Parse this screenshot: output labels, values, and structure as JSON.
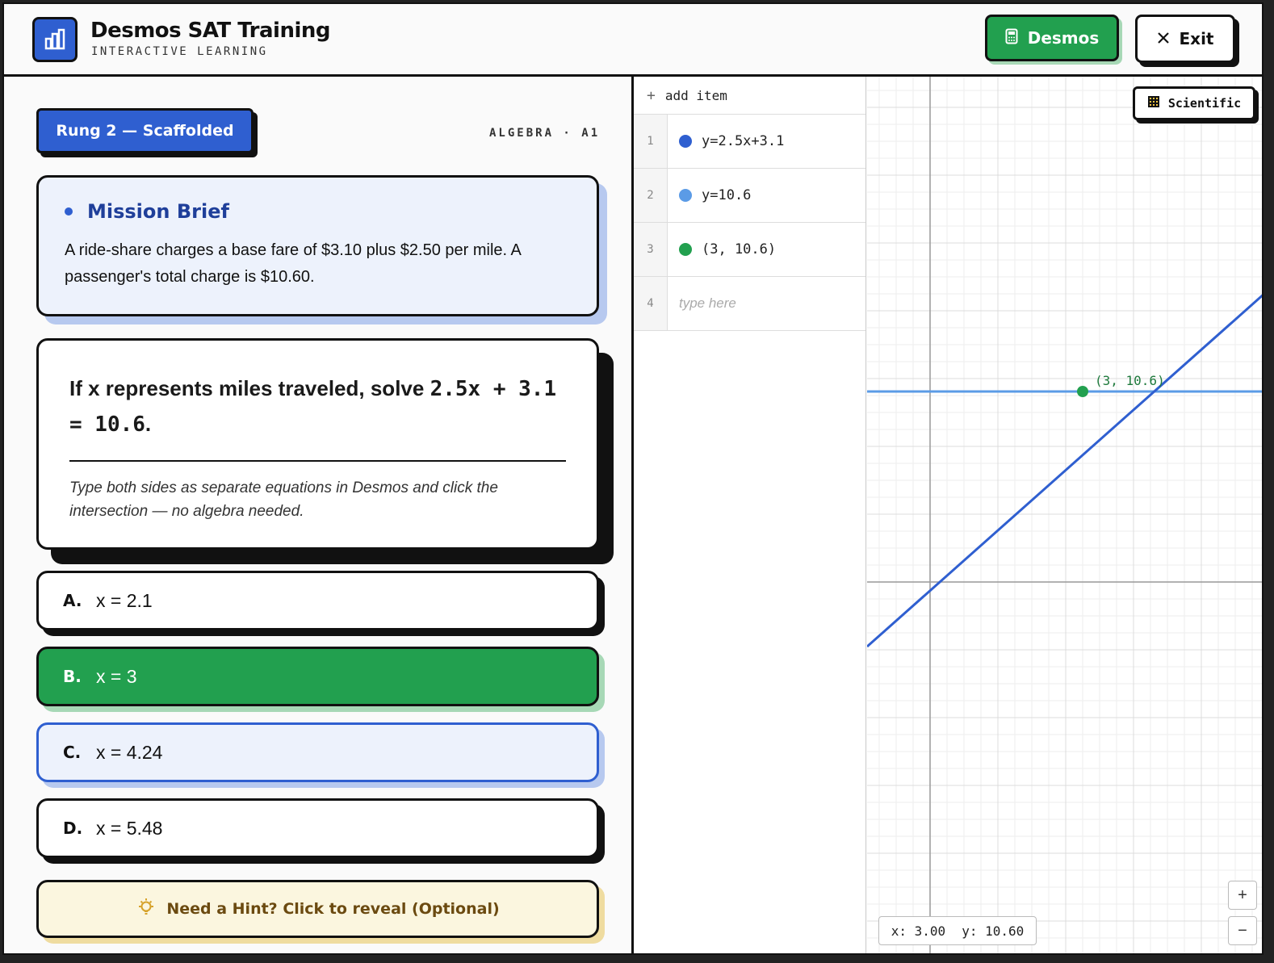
{
  "header": {
    "title": "Desmos SAT Training",
    "subtitle": "INTERACTIVE LEARNING",
    "desmos_label": "Desmos",
    "exit_label": "Exit"
  },
  "lesson": {
    "rung_label": "Rung 2 — Scaffolded",
    "topic": "ALGEBRA · A1"
  },
  "brief": {
    "title": "Mission Brief",
    "text": "A ride-share charges a base fare of $3.10 plus $2.50 per mile. A passenger's total charge is $10.60."
  },
  "question": {
    "prompt": "If x represents miles traveled, solve",
    "equation": "2.5x + 3.1 = 10.6",
    "period": ".",
    "note": "Type both sides as separate equations in Desmos and click the intersection — no algebra needed."
  },
  "choices": [
    {
      "letter": "A.",
      "text": "x = 2.1",
      "state": "default"
    },
    {
      "letter": "B.",
      "text": "x = 3",
      "state": "correct"
    },
    {
      "letter": "C.",
      "text": "x = 4.24",
      "state": "hover"
    },
    {
      "letter": "D.",
      "text": "x = 5.48",
      "state": "default"
    }
  ],
  "hint_label": "Need a Hint? Click to reveal (Optional)",
  "desmos": {
    "add_item": "add item",
    "expressions": [
      {
        "num": "1",
        "text": "y=2.5x+3.1",
        "color": "#2f5fd0"
      },
      {
        "num": "2",
        "text": "y=10.6",
        "color": "#5b9be6"
      },
      {
        "num": "3",
        "text": "(3, 10.6)",
        "color": "#22a04f"
      }
    ],
    "empty_row": {
      "num": "4",
      "placeholder": "type here"
    },
    "scientific_label": "Scientific",
    "point_label": "(3, 10.6)",
    "readout_x": "x: 3.00",
    "readout_y": "y: 10.60",
    "zoom_in": "+",
    "zoom_out": "−"
  },
  "colors": {
    "accent_blue": "#2f5fd0",
    "success_green": "#22a04f",
    "hint_bg": "#fbf6df"
  }
}
